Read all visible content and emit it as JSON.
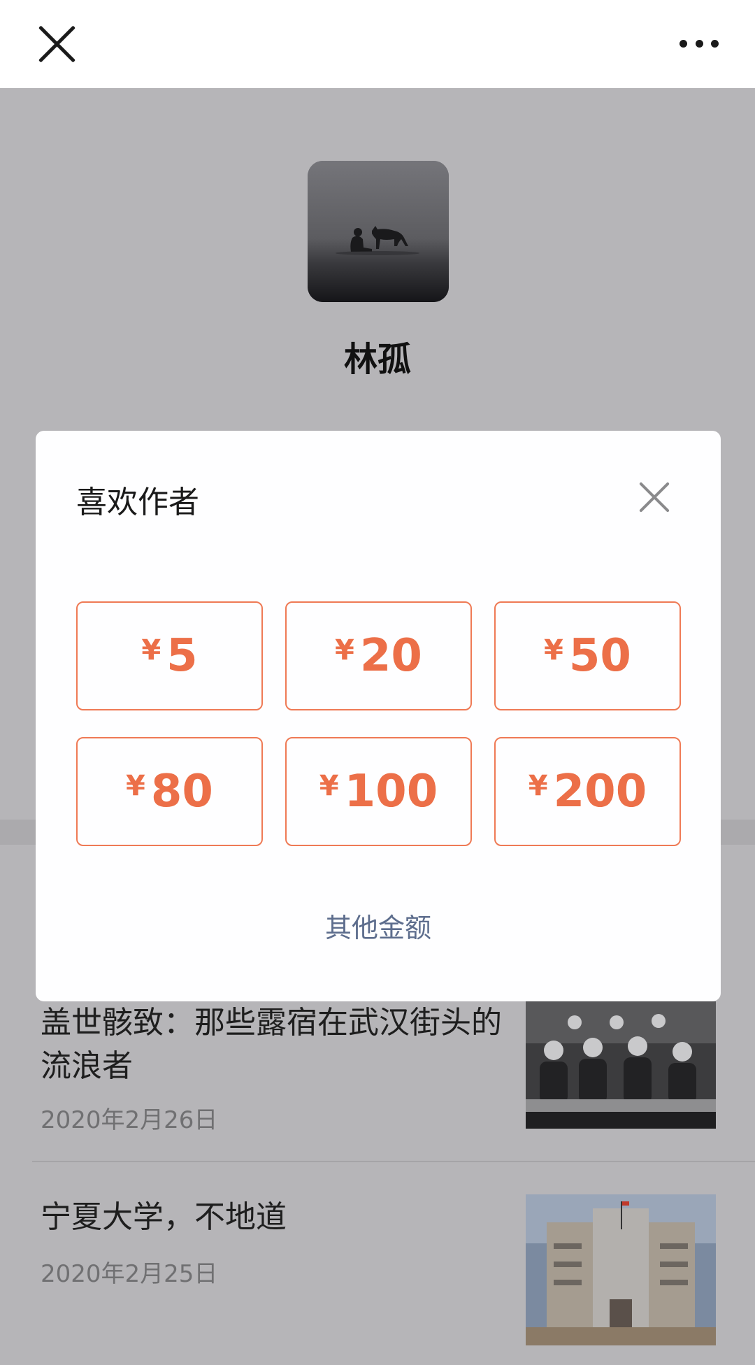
{
  "topbar": {
    "close_icon": "close-icon",
    "more_icon": "more-dots-icon"
  },
  "profile": {
    "avatar_icon": "author-avatar-image",
    "name": "林孤"
  },
  "articles": [
    {
      "title": "盖世骸致：那些露宿在武汉街头的流浪者",
      "date": "2020年2月26日"
    },
    {
      "title": "宁夏大学，不地道",
      "date": "2020年2月25日"
    }
  ],
  "modal": {
    "title": "喜欢作者",
    "close_icon": "close-icon",
    "currency_symbol": "¥",
    "amounts": [
      "5",
      "20",
      "50",
      "80",
      "100",
      "200"
    ],
    "other_amount_label": "其他金额",
    "accent_color": "#ec6f48",
    "link_color": "#5d6d8d"
  }
}
